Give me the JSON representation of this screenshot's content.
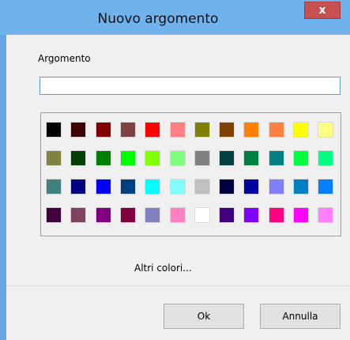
{
  "window": {
    "title": "Nuovo argomento",
    "close_label": "x"
  },
  "form": {
    "argument_label": "Argomento",
    "argument_value": "",
    "more_colors_label": "Altri colori..."
  },
  "palette": {
    "rows": [
      [
        "#000000",
        "#400000",
        "#800000",
        "#804040",
        "#ff0000",
        "#ff8080",
        "#808000",
        "#804000",
        "#ff8000",
        "#ff8040",
        "#ffff00",
        "#ffff80"
      ],
      [
        "#808040",
        "#004000",
        "#008000",
        "#00ff00",
        "#80ff00",
        "#80ff80",
        "#808080",
        "#004040",
        "#008040",
        "#008080",
        "#00ff40",
        "#00ff80"
      ],
      [
        "#408080",
        "#000080",
        "#0000ff",
        "#004080",
        "#00ffff",
        "#80ffff",
        "#c0c0c0",
        "#000040",
        "#0000a0",
        "#8080ff",
        "#0080c0",
        "#0080ff"
      ],
      [
        "#400040",
        "#804060",
        "#800080",
        "#800040",
        "#8080c0",
        "#ff80c0",
        "#ffffff",
        "#400080",
        "#8000ff",
        "#ff0080",
        "#ff00ff",
        "#ff80ff"
      ]
    ]
  },
  "buttons": {
    "ok_label": "Ok",
    "cancel_label": "Annulla"
  }
}
